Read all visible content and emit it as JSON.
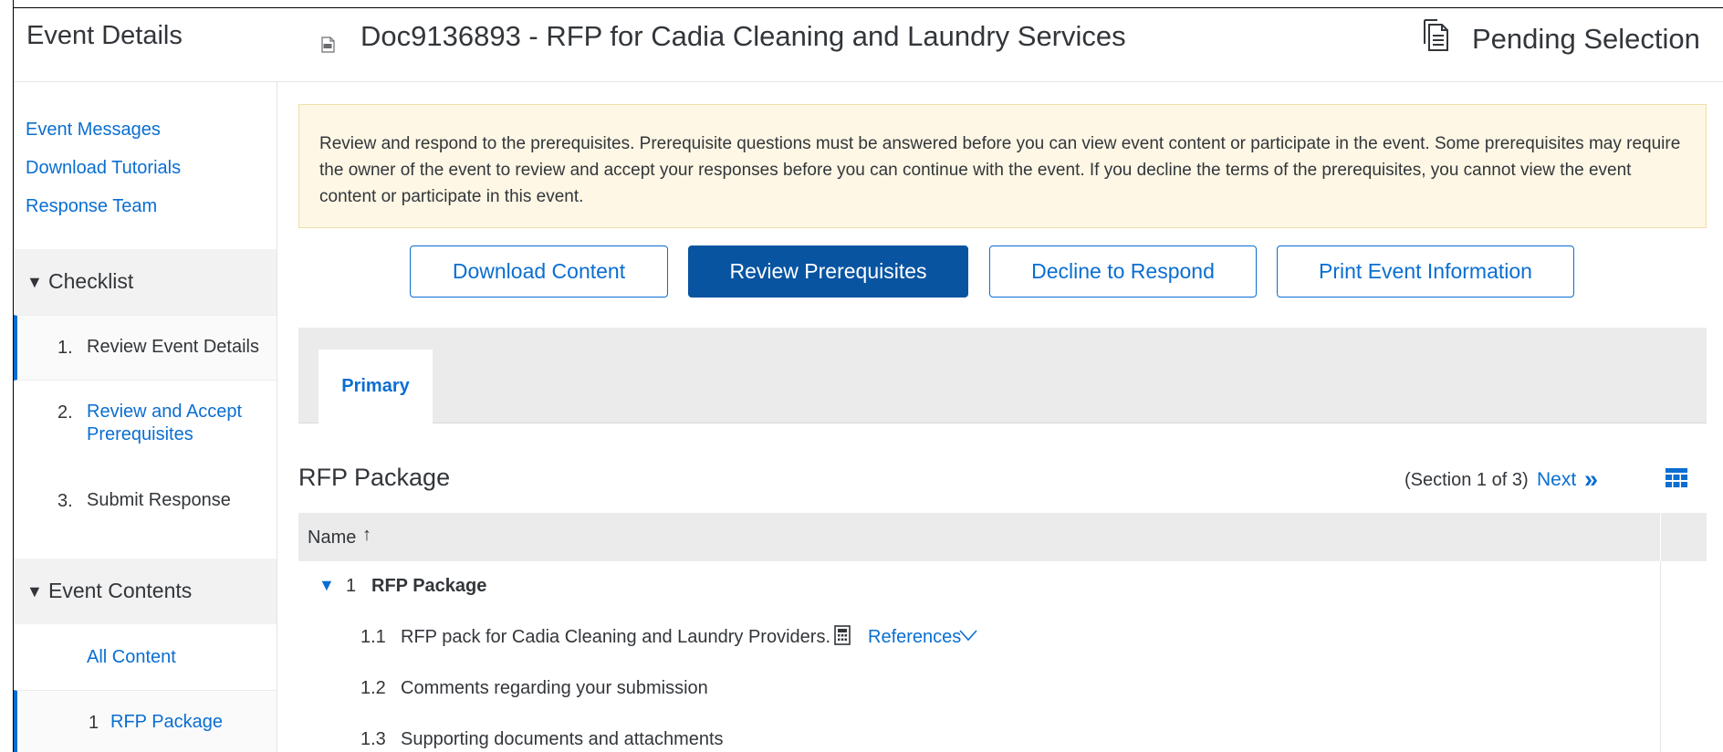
{
  "header": {
    "section_title": "Event Details",
    "doc_icon": "rfp-document-icon",
    "doc_title": "Doc9136893 - RFP for Cadia Cleaning and Laundry Services",
    "status_icon": "pending-document-icon",
    "status": "Pending Selection"
  },
  "sidebar": {
    "links": [
      "Event Messages",
      "Download Tutorials",
      "Response Team"
    ],
    "checklist": {
      "title": "Checklist",
      "items": [
        {
          "num": "1.",
          "label": "Review Event Details"
        },
        {
          "num": "2.",
          "label": "Review and Accept Prerequisites"
        },
        {
          "num": "3.",
          "label": "Submit Response"
        }
      ]
    },
    "contents": {
      "title": "Event Contents",
      "all": "All Content",
      "items": [
        {
          "num": "1",
          "label": "RFP Package"
        }
      ]
    }
  },
  "notice": "Review and respond to the prerequisites. Prerequisite questions must be answered before you can view event content or participate in the event. Some prerequisites may require the owner of the event to review and accept your responses before you can continue with the event. If you decline the terms of the prerequisites, you cannot view the event content or participate in this event.",
  "buttons": {
    "download": "Download Content",
    "review": "Review Prerequisites",
    "decline": "Decline to Respond",
    "print": "Print Event Information"
  },
  "tabs": {
    "primary": "Primary"
  },
  "section": {
    "title": "RFP Package",
    "info": "(Section 1 of 3)",
    "next": "Next",
    "next_glyph": "»"
  },
  "table": {
    "col_name": "Name",
    "sort_glyph": "↑",
    "rows": [
      {
        "num": "1",
        "label": "RFP Package"
      },
      {
        "num": "1.1",
        "label": "RFP pack for Cadia Cleaning and Laundry Providers.",
        "link": "References"
      },
      {
        "num": "1.2",
        "label": "Comments regarding your submission"
      },
      {
        "num": "1.3",
        "label": "Supporting documents and attachments"
      }
    ]
  },
  "colors": {
    "accent": "#0a6ed1",
    "primary_button": "#0854a1",
    "notice_bg": "#fef7e5"
  }
}
